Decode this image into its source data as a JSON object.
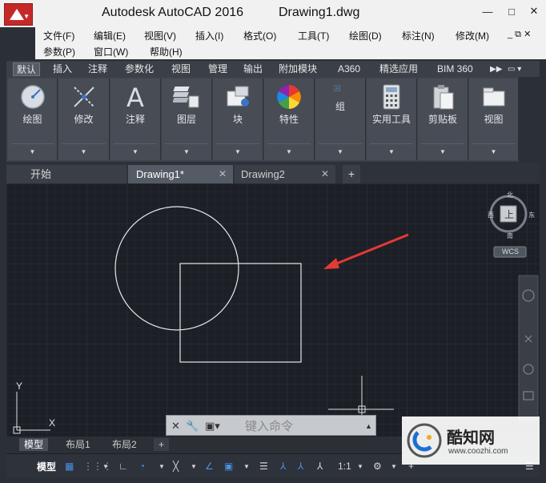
{
  "title": {
    "app": "Autodesk AutoCAD 2016",
    "document": "Drawing1.dwg"
  },
  "window_controls": {
    "minimize": "—",
    "maximize": "□",
    "close": "✕",
    "doc_controls": "_ ⧉ ✕"
  },
  "menu": [
    "文件(F)",
    "编辑(E)",
    "视图(V)",
    "插入(I)",
    "格式(O)",
    "工具(T)",
    "绘图(D)",
    "标注(N)",
    "修改(M)",
    "参数(P)",
    "窗口(W)",
    "帮助(H)"
  ],
  "ribbon_tabs": [
    "默认",
    "插入",
    "注释",
    "参数化",
    "视图",
    "管理",
    "输出",
    "附加模块",
    "A360",
    "精选应用",
    "BIM 360"
  ],
  "ribbon_panels": [
    {
      "label": "绘图",
      "icon": "draw-circle-icon"
    },
    {
      "label": "修改",
      "icon": "modify-icon"
    },
    {
      "label": "注释",
      "icon": "annotation-text-icon"
    },
    {
      "label": "图层",
      "icon": "layers-icon"
    },
    {
      "label": "块",
      "icon": "block-icon"
    },
    {
      "label": "特性",
      "icon": "properties-color-wheel-icon"
    },
    {
      "label": "组",
      "icon": "group-icon"
    },
    {
      "label": "实用工具",
      "icon": "calculator-icon"
    },
    {
      "label": "剪贴板",
      "icon": "clipboard-icon"
    },
    {
      "label": "视图",
      "icon": "view-icon"
    }
  ],
  "file_tabs": [
    {
      "label": "开始"
    },
    {
      "label": "Drawing1*",
      "close": "✕"
    },
    {
      "label": "Drawing2",
      "close": "✕"
    },
    {
      "label": "+"
    }
  ],
  "viewcube": {
    "north": "北",
    "south": "南",
    "east": "东",
    "west": "西",
    "face": "上",
    "wcs": "WCS"
  },
  "ucs": {
    "x": "X",
    "y": "Y"
  },
  "command_line": {
    "placeholder": "键入命令"
  },
  "layout_tabs": [
    "模型",
    "布局1",
    "布局2",
    "+"
  ],
  "status_bar": {
    "model": "模型",
    "scale": "1:1"
  },
  "watermark": {
    "brand": "酷知网",
    "url": "www.coozhi.com"
  },
  "colors": {
    "accent_red": "#c62828",
    "canvas_bg": "#1c1f26",
    "arrow_red": "#e53935"
  }
}
